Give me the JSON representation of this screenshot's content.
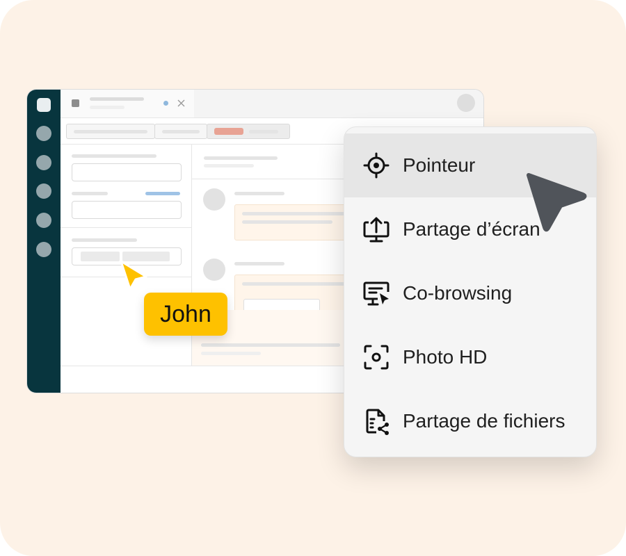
{
  "menu": {
    "items": [
      {
        "label": "Pointeur",
        "icon": "crosshair-icon",
        "active": true
      },
      {
        "label": "Partage d’écran",
        "icon": "screen-share-icon",
        "active": false
      },
      {
        "label": "Co-browsing",
        "icon": "co-browsing-icon",
        "active": false
      },
      {
        "label": "Photo HD",
        "icon": "photo-focus-icon",
        "active": false
      },
      {
        "label": "Partage de fichiers",
        "icon": "file-share-icon",
        "active": false
      }
    ]
  },
  "cursor_badge": {
    "name": "John",
    "color": "#fec100"
  },
  "colors": {
    "background": "#fdf2e7",
    "sidebar": "#08353e",
    "accent_red": "#e8a394",
    "accent_blue": "#9fc3e6",
    "cursor_dark": "#50545a"
  }
}
